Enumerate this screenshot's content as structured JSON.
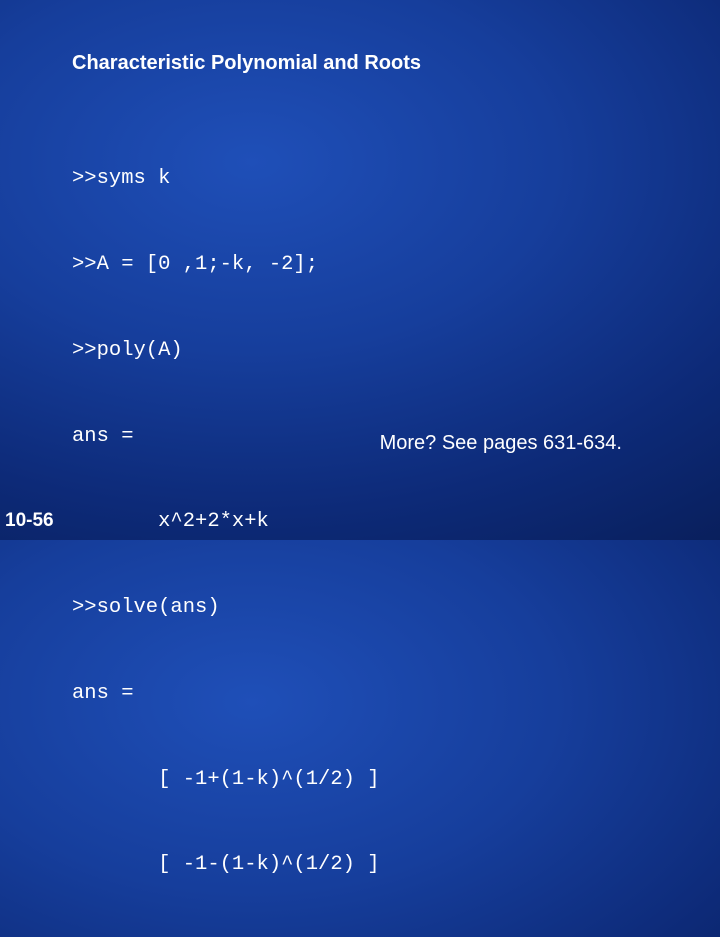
{
  "slide": {
    "title": "Characteristic Polynomial and Roots",
    "code_lines": [
      ">>syms k",
      ">>A = [0 ,1;-k, -2];",
      ">>poly(A)",
      "ans =",
      "       x^2+2*x+k",
      ">>solve(ans)",
      "ans =",
      "       [ -1+(1-k)^(1/2) ]",
      "       [ -1-(1-k)^(1/2) ]"
    ],
    "more_note": "More? See pages 631-634.",
    "page_number": "10-56"
  }
}
